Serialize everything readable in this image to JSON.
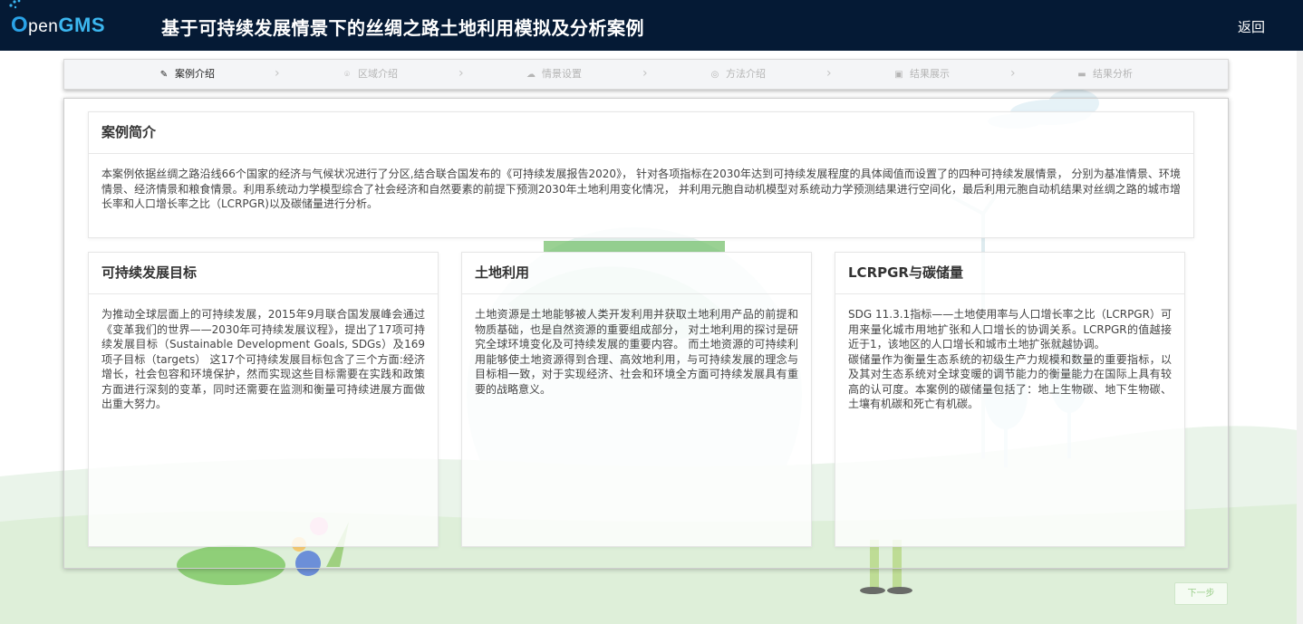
{
  "header": {
    "logo_o": "O",
    "logo_pen": "pen",
    "logo_gms": "GMS",
    "title": "基于可持续发展情景下的丝绸之路土地利用模拟及分析案例",
    "back_label": "返回"
  },
  "steps": [
    {
      "label": "案例介绍",
      "icon": "edit-icon",
      "active": true
    },
    {
      "label": "区域介绍",
      "icon": "location-icon",
      "active": false
    },
    {
      "label": "情景设置",
      "icon": "cloud-icon",
      "active": false
    },
    {
      "label": "方法介绍",
      "icon": "chat-icon",
      "active": false
    },
    {
      "label": "结果展示",
      "icon": "picture-icon",
      "active": false
    },
    {
      "label": "结果分析",
      "icon": "monitor-icon",
      "active": false
    }
  ],
  "intro": {
    "title": "案例简介",
    "text": "本案例依据丝绸之路沿线66个国家的经济与气候状况进行了分区,结合联合国发布的《可持续发展报告2020》， 针对各项指标在2030年达到可持续发展程度的具体阈值而设置了的四种可持续发展情景， 分别为基准情景、环境情景、经济情景和粮食情景。利用系统动力学模型综合了社会经济和自然要素的前提下预测2030年土地利用变化情况， 并利用元胞自动机模型对系统动力学预测结果进行空间化，最后利用元胞自动机结果对丝绸之路的城市增长率和人口增长率之比（LCRPGR)以及碳储量进行分析。"
  },
  "cards": [
    {
      "title": "可持续发展目标",
      "text": "为推动全球层面上的可持续发展，2015年9月联合国发展峰会通过《变革我们的世界——2030年可持续发展议程》，提出了17项可持续发展目标（Sustainable Development Goals, SDGs）及169项子目标（targets） 这17个可持续发展目标包含了三个方面:经济增长，社会包容和环境保护，然而实现这些目标需要在实践和政策方面进行深刻的变革，同时还需要在监测和衡量可持续进展方面做出重大努力。"
    },
    {
      "title": "土地利用",
      "text": "土地资源是土地能够被人类开发利用并获取土地利用产品的前提和物质基础，也是自然资源的重要组成部分， 对土地利用的探讨是研究全球环境变化及可持续发展的重要内容。 而土地资源的可持续利用能够使土地资源得到合理、高效地利用，与可持续发展的理念与目标相一致，对于实现经济、社会和环境全方面可持续发展具有重要的战略意义。"
    },
    {
      "title": "LCRPGR与碳储量",
      "text": "SDG 11.3.1指标——土地使用率与人口增长率之比（LCRPGR）可用来量化城市用地扩张和人口增长的协调关系。LCRPGR的值越接近于1，该地区的人口增长和城市土地扩张就越协调。\n碳储量作为衡量生态系统的初级生产力规模和数量的重要指标，以及其对生态系统对全球变暖的调节能力的衡量能力在国际上具有较高的认可度。本案例的碳储量包括了：地上生物碳、地下生物碳、土壤有机碳和死亡有机碳。"
    }
  ],
  "footer": {
    "next_label": "下一步"
  },
  "colors": {
    "header_bg": "#051a35",
    "accent_green": "#9ccf8c",
    "logo_blue": "#2aa3e8"
  }
}
